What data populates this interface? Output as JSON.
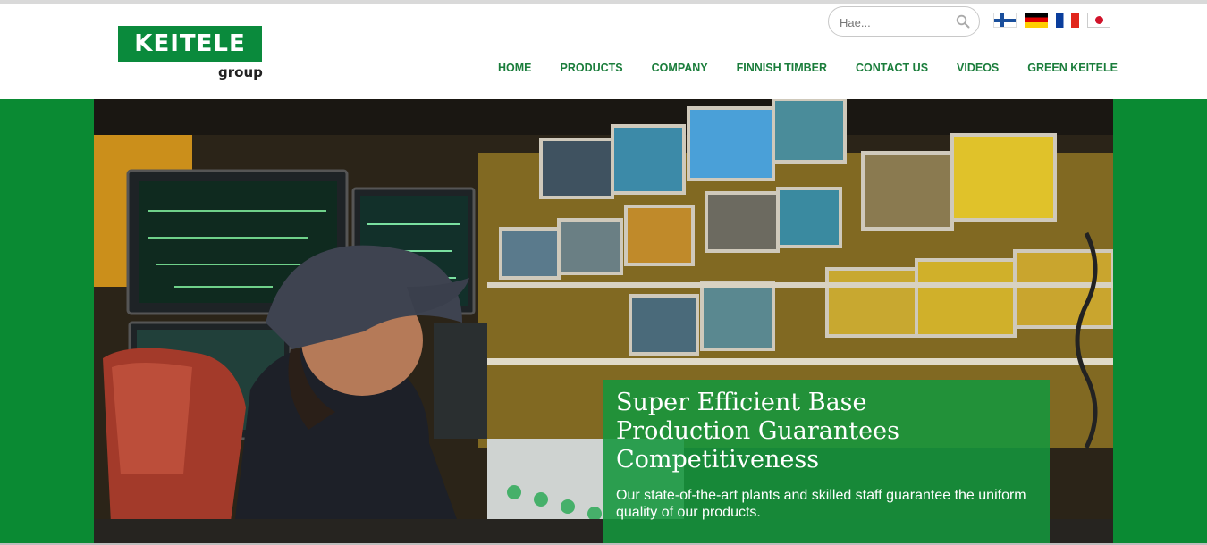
{
  "brand": {
    "name": "KEITELE",
    "sub": "group",
    "color": "#0a8a3c"
  },
  "search": {
    "placeholder": "Hae...",
    "icon": "search-icon"
  },
  "languages": [
    {
      "code": "fi",
      "icon": "finnish-flag-icon"
    },
    {
      "code": "de",
      "icon": "german-flag-icon"
    },
    {
      "code": "fr",
      "icon": "french-flag-icon"
    },
    {
      "code": "ja",
      "icon": "japanese-flag-icon"
    }
  ],
  "nav": {
    "items": [
      "HOME",
      "PRODUCTS",
      "COMPANY",
      "FINNISH TIMBER",
      "CONTACT US",
      "VIDEOS",
      "GREEN KEITELE"
    ],
    "color": "#1a7d3b"
  },
  "hero": {
    "image": "control-room-operator-photo",
    "title": "Super Efficient Base Production Guarantees Competitiveness",
    "text": "Our state-of-the-art plants and skilled staff guarantee the uniform quality of our products.",
    "caption_bg": "#14963c",
    "banner_bg": "#0a8a33"
  }
}
